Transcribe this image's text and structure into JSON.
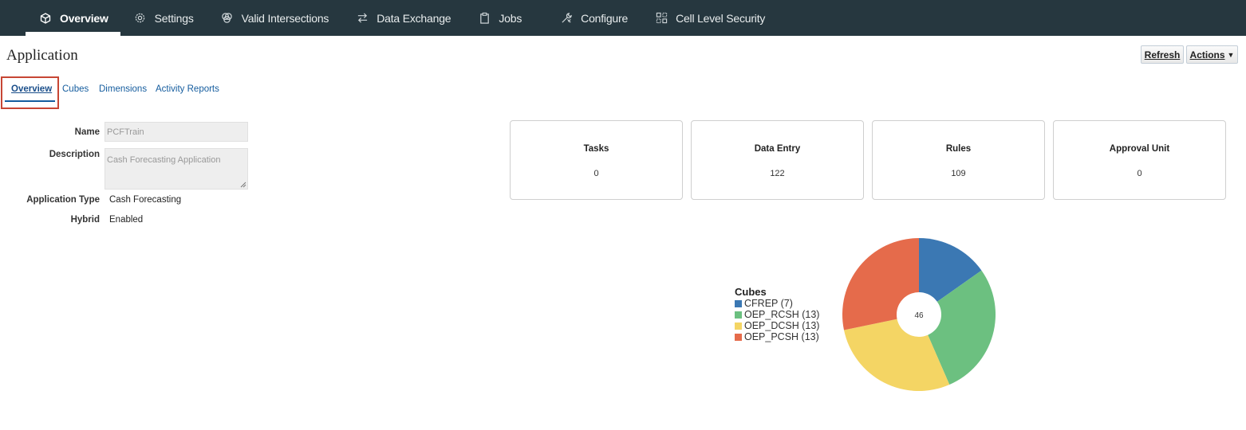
{
  "topnav": {
    "items": [
      {
        "label": "Overview",
        "icon": "cube-icon",
        "active": true
      },
      {
        "label": "Settings",
        "icon": "gear-icon"
      },
      {
        "label": "Valid Intersections",
        "icon": "intersections-icon"
      },
      {
        "label": "Data Exchange",
        "icon": "exchange-arrows-icon"
      },
      {
        "label": "Jobs",
        "icon": "clipboard-icon"
      },
      {
        "label": "Configure",
        "icon": "tools-icon"
      },
      {
        "label": "Cell Level Security",
        "icon": "grid-security-icon"
      }
    ]
  },
  "page": {
    "title": "Application",
    "refresh_label": "Refresh",
    "actions_label": "Actions"
  },
  "subtabs": [
    {
      "label": "Overview",
      "active": true
    },
    {
      "label": "Cubes"
    },
    {
      "label": "Dimensions"
    },
    {
      "label": "Activity Reports"
    }
  ],
  "form": {
    "name_label": "Name",
    "name_value": "PCFTrain",
    "description_label": "Description",
    "description_value": "Cash Forecasting Application",
    "app_type_label": "Application Type",
    "app_type_value": "Cash Forecasting",
    "hybrid_label": "Hybrid",
    "hybrid_value": "Enabled"
  },
  "cards": [
    {
      "title": "Tasks",
      "value": "0"
    },
    {
      "title": "Data Entry",
      "value": "122"
    },
    {
      "title": "Rules",
      "value": "109"
    },
    {
      "title": "Approval Unit",
      "value": "0"
    }
  ],
  "chart_data": {
    "type": "pie",
    "title": "Cubes",
    "center_label": "46",
    "slices": [
      {
        "name": "CFREP (7)",
        "value": 7,
        "color": "#3b78b3"
      },
      {
        "name": "OEP_RCSH (13)",
        "value": 13,
        "color": "#6cc080"
      },
      {
        "name": "OEP_DCSH (13)",
        "value": 13,
        "color": "#f4d564"
      },
      {
        "name": "OEP_PCSH (13)",
        "value": 13,
        "color": "#e56b4b"
      }
    ],
    "legend_position": "left"
  },
  "colors": {
    "nav_bg": "#26373f",
    "link": "#145c9e",
    "highlight": "#c74634"
  }
}
